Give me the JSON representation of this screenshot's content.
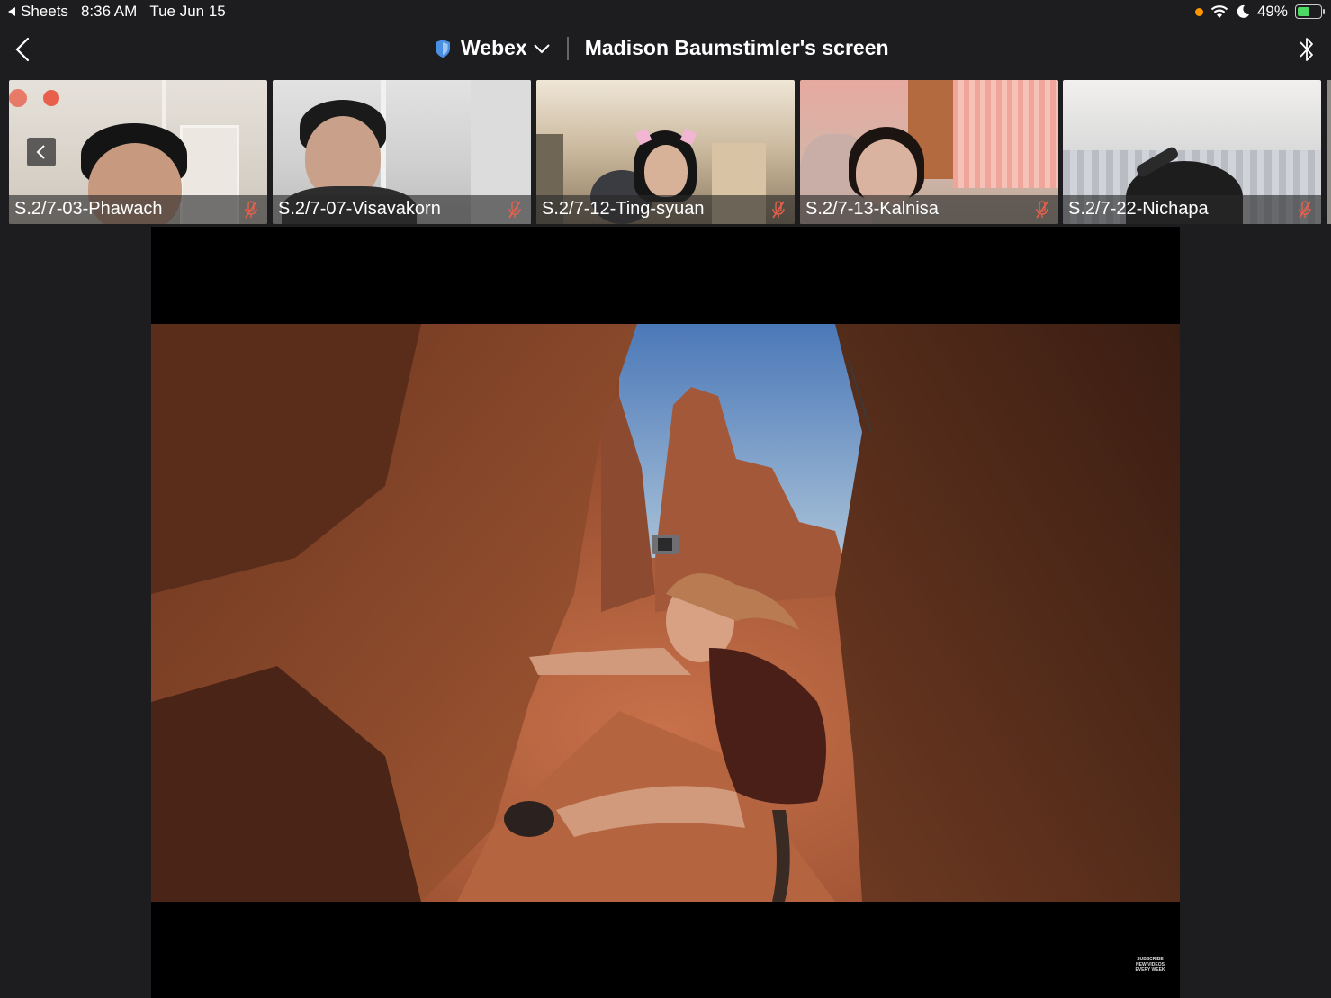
{
  "status_bar": {
    "back_app": "Sheets",
    "time": "8:36 AM",
    "date": "Tue Jun 15",
    "battery": "49%"
  },
  "header": {
    "app_name": "Webex",
    "shared_screen_title": "Madison Baumstimler's screen"
  },
  "participants": [
    {
      "name": "S.2/7-03-Phawach",
      "muted": true
    },
    {
      "name": "S.2/7-07-Visavakorn",
      "muted": true
    },
    {
      "name": "S.2/7-12-Ting-syuan",
      "muted": true
    },
    {
      "name": "S.2/7-13-Kalnisa",
      "muted": true
    },
    {
      "name": "S.2/7-22-Nichapa",
      "muted": true
    }
  ],
  "shared_content": {
    "watermark_lines": [
      "SUBSCRIBE",
      "NEW VIDEOS",
      "EVERY WEEK"
    ]
  },
  "colors": {
    "background": "#1d1d1f",
    "record_dot": "#e8604c",
    "mute_icon": "#e8604c",
    "shield": "#4a90e2"
  }
}
